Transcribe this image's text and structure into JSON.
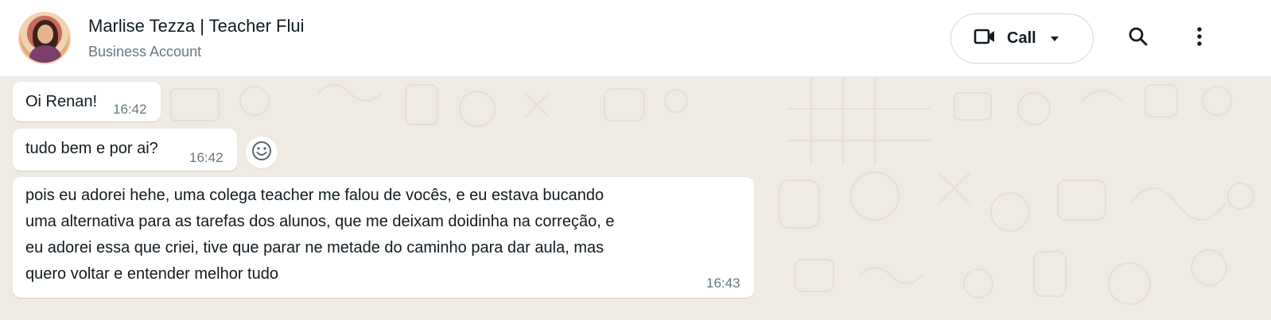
{
  "header": {
    "contact_name": "Marlise Tezza | Teacher Flui",
    "contact_subtitle": "Business Account",
    "avatar_icon": "contact-avatar",
    "call_label": "Call",
    "call_icon": "video-camera-icon",
    "search_icon": "search-icon",
    "menu_icon": "kebab-menu-icon"
  },
  "messages": [
    {
      "text": "Oi Renan!",
      "time": "16:42"
    },
    {
      "text": "tudo bem e por ai?",
      "time": "16:42"
    },
    {
      "lines": [
        "pois eu adorei hehe, uma colega teacher me falou de vocês, e eu estava bucando",
        "uma alternativa para as tarefas dos alunos, que me deixam doidinha na correção, e",
        "eu adorei essa que criei, tive que parar ne metade do caminho para dar aula, mas",
        "quero voltar e entender melhor tudo"
      ],
      "time": "16:43"
    }
  ],
  "reaction_icon": "emoji-smile-icon",
  "colors": {
    "chat_background": "#efeae2",
    "bubble": "#ffffff",
    "secondary_text": "#667781",
    "primary_text": "#111b21"
  }
}
